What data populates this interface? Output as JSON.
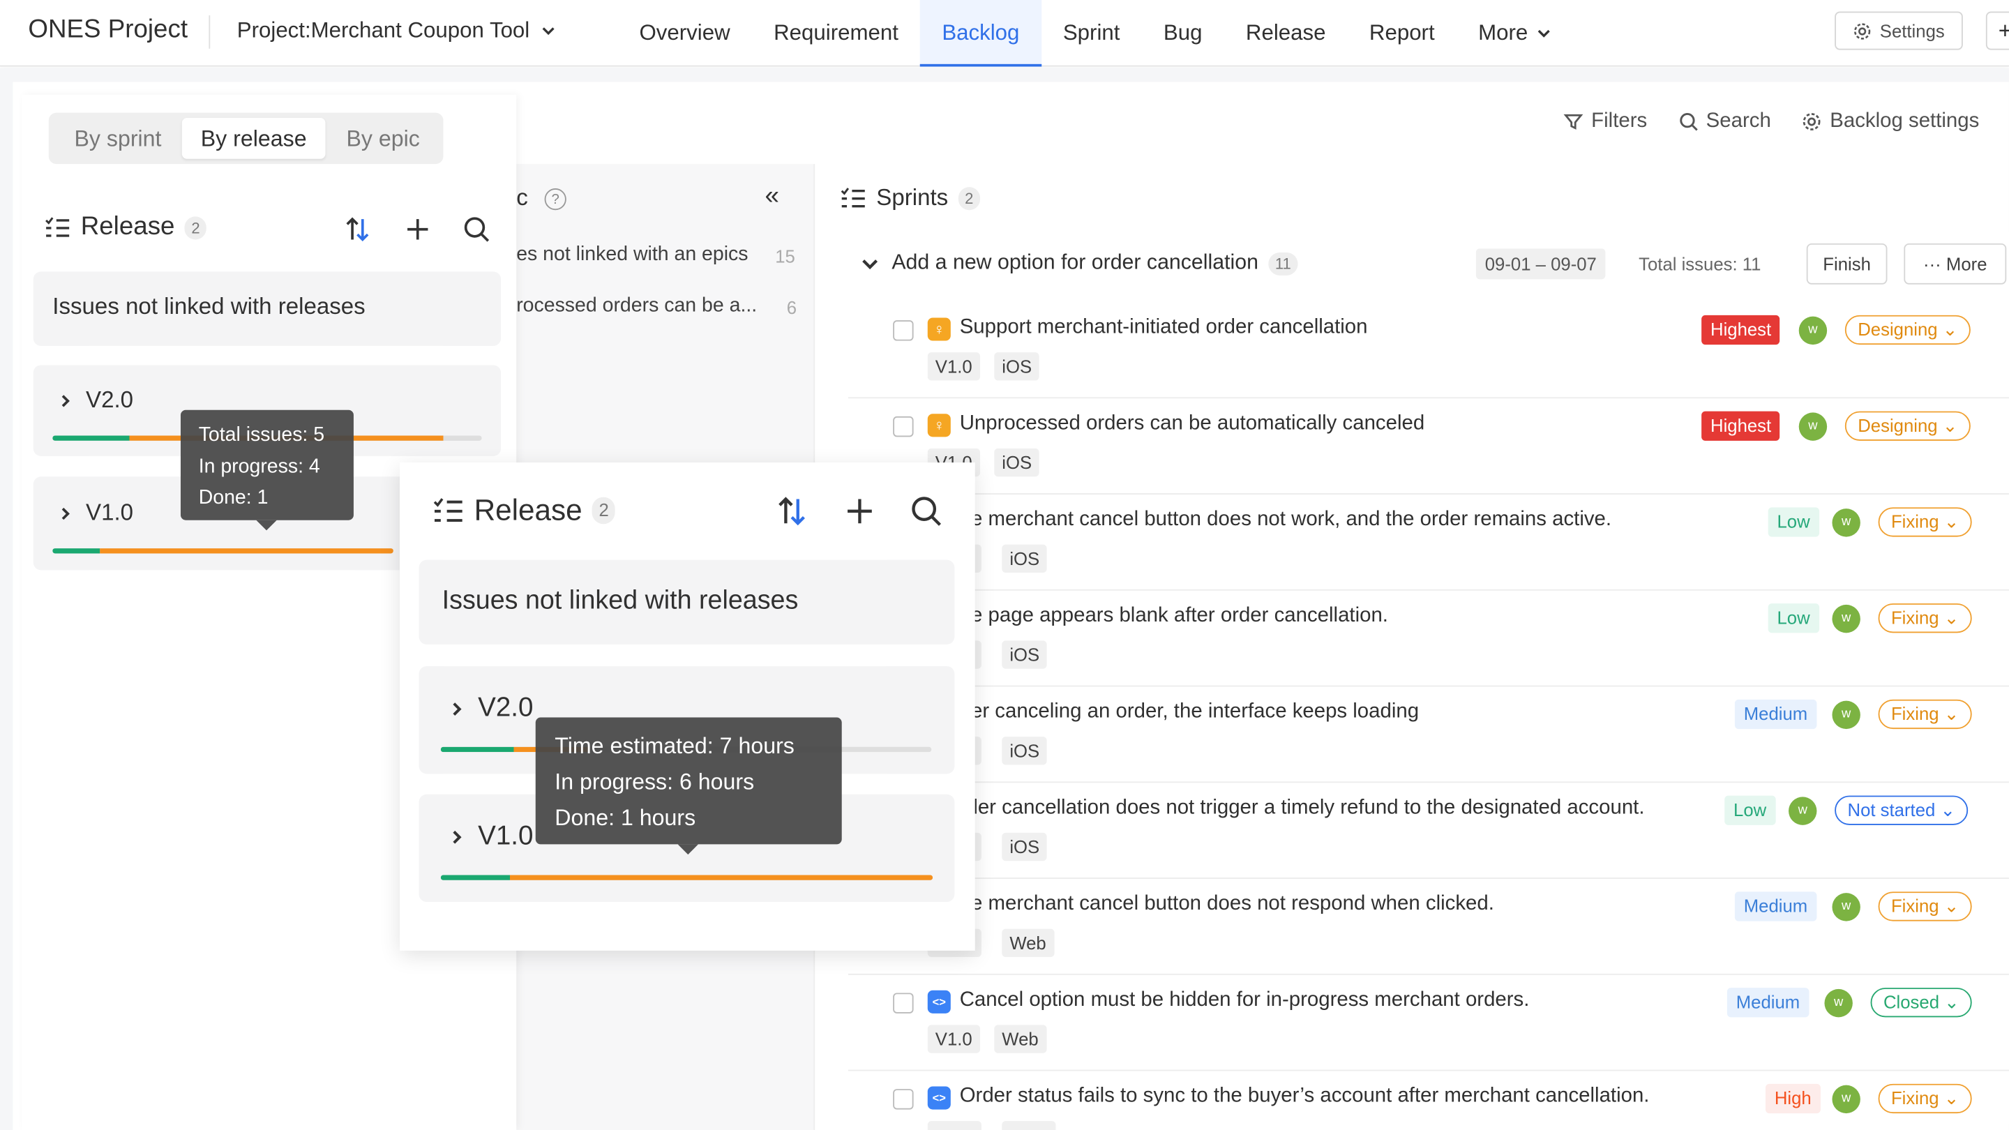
{
  "nav": {
    "brand": "ONES Project",
    "project": "Project:Merchant Coupon Tool",
    "tabs": [
      "Overview",
      "Requirement",
      "Backlog",
      "Sprint",
      "Bug",
      "Release",
      "Report",
      "More"
    ],
    "active_tab": "Backlog",
    "settings": "Settings"
  },
  "toolbar": {
    "filters": "Filters",
    "search": "Search",
    "backlog_settings": "Backlog settings"
  },
  "view_switch": {
    "items": [
      "By sprint",
      "By release",
      "By epic"
    ],
    "selected": "By release"
  },
  "release_panel": {
    "title": "Release",
    "count": "2",
    "not_linked": "Issues not linked with releases",
    "versions": [
      {
        "label": "V2.0",
        "done_fraction": 0.18,
        "in_progress_fraction": 0.73
      },
      {
        "label": "V1.0",
        "done_fraction": 0.14,
        "in_progress_fraction": 0.86
      }
    ],
    "tooltip_issues": {
      "total": "Total issues: 5",
      "in_progress": "In progress: 4",
      "done": "Done: 1"
    }
  },
  "zoom_panel": {
    "title": "Release",
    "count": "2",
    "not_linked": "Issues not linked with releases",
    "versions": [
      {
        "label": "V2.0",
        "done_fraction": 0.15,
        "in_progress_fraction": 0.15
      },
      {
        "label": "V1.0",
        "done_fraction": 0.14,
        "in_progress_fraction": 0.86
      }
    ],
    "tooltip_hours": {
      "estimated": "Time estimated: 7 hours",
      "in_progress": "In progress: 6 hours",
      "done": "Done: 1 hours"
    }
  },
  "epic_column": {
    "title_fragment": "c",
    "rows": [
      {
        "text": "es not linked with an epics",
        "count": "15"
      },
      {
        "text": "rocessed orders can be a...",
        "count": "6"
      }
    ]
  },
  "sprints": {
    "title": "Sprints",
    "count": "2",
    "sprint": {
      "name": "Add a new option for order cancellation",
      "count": "11",
      "dates": "09-01 – 09-07",
      "total": "Total issues: 11",
      "finish": "Finish",
      "more": "More"
    },
    "issues": [
      {
        "title": "Support merchant-initiated order cancellation",
        "type": "req",
        "tags": [
          "V1.0",
          "iOS"
        ],
        "priority": "Highest",
        "status": "Designing",
        "avatar": "w"
      },
      {
        "title": "Unprocessed orders can be automatically canceled",
        "type": "req",
        "tags": [
          "V1.0",
          "iOS"
        ],
        "priority": "Highest",
        "status": "Designing",
        "avatar": "w"
      },
      {
        "title": "he merchant cancel button does not work, and the order remains active.",
        "type": "bug",
        "tags": [
          "",
          "iOS"
        ],
        "priority": "Low",
        "status": "Fixing",
        "avatar": "w"
      },
      {
        "title": "he page appears blank after order cancellation.",
        "type": "bug",
        "tags": [
          "",
          "iOS"
        ],
        "priority": "Low",
        "status": "Fixing",
        "avatar": "w"
      },
      {
        "title": "fter canceling an order, the interface keeps loading",
        "type": "bug",
        "tags": [
          "",
          "iOS"
        ],
        "priority": "Medium",
        "status": "Fixing",
        "avatar": "w"
      },
      {
        "title": "rder cancellation does not trigger a timely refund to the designated account.",
        "type": "bug",
        "tags": [
          "",
          "iOS"
        ],
        "priority": "Low",
        "status": "Not started",
        "avatar": "w"
      },
      {
        "title": "he merchant cancel button does not respond when clicked.",
        "type": "bug",
        "tags": [
          "",
          "Web"
        ],
        "priority": "Medium",
        "status": "Fixing",
        "avatar": "w"
      },
      {
        "title": "Cancel option must be hidden for in-progress merchant orders.",
        "type": "dev",
        "tags": [
          "V1.0",
          "Web"
        ],
        "priority": "Medium",
        "status": "Closed",
        "avatar": "w"
      },
      {
        "title": "Order status fails to sync to the buyer’s account after merchant cancellation.",
        "type": "dev",
        "tags": [
          "",
          ""
        ],
        "priority": "High",
        "status": "Fixing",
        "avatar": "w"
      }
    ]
  },
  "colors": {
    "accent": "#3070e8",
    "done": "#1aa870",
    "in_progress": "#f5901e",
    "highest": "#e53935"
  }
}
